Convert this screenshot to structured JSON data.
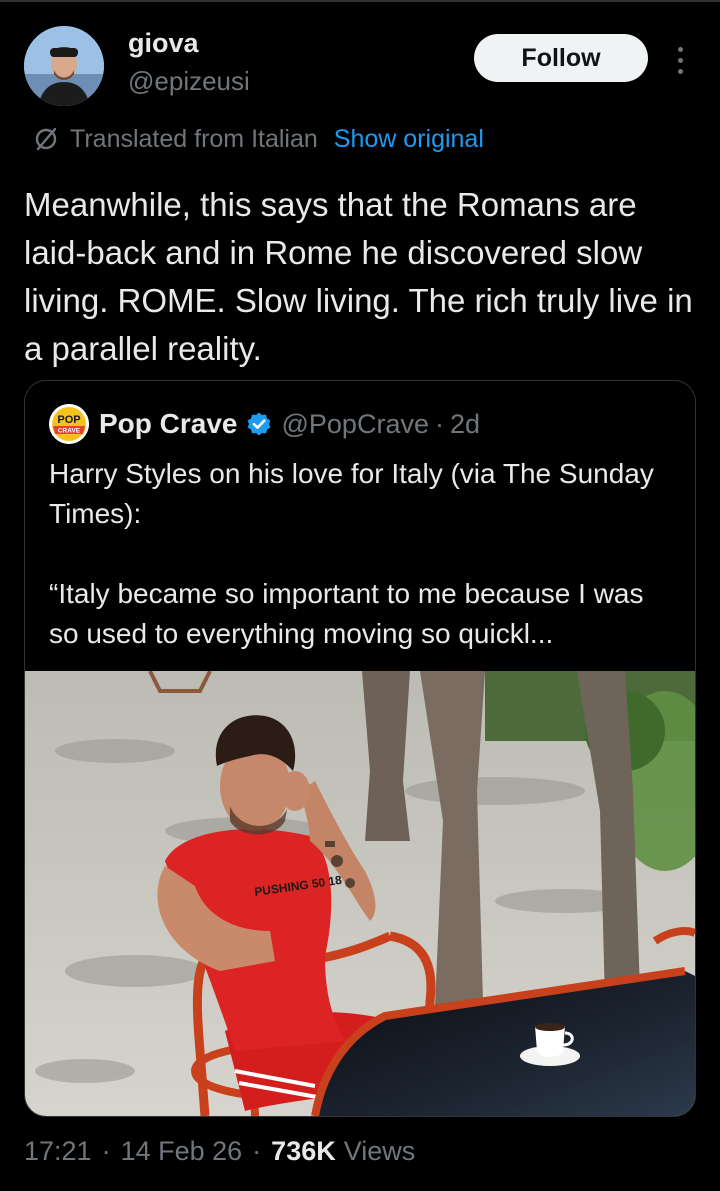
{
  "author": {
    "display_name": "giova",
    "handle": "@epizeusi"
  },
  "actions": {
    "follow_label": "Follow"
  },
  "translation": {
    "label": "Translated from Italian",
    "show_original": "Show original"
  },
  "tweet": {
    "text": "Meanwhile, this says that the Romans are laid-back and in Rome he discovered slow living. ROME. Slow living. The rich truly live in a parallel reality."
  },
  "quote": {
    "avatar_label": "POP CRAVE",
    "name": "Pop Crave",
    "handle": "@PopCrave",
    "separator": "·",
    "time": "2d",
    "line1": "Harry Styles on his love for Italy (via The Sunday Times):",
    "line2": "“Italy became so important to me because I was so used to everything moving so quickl...",
    "shirt_text": "PUSHING 50 18"
  },
  "meta": {
    "time": "17:21",
    "sep": "·",
    "date": "14 Feb 26",
    "views_count": "736K",
    "views_label": "Views"
  },
  "colors": {
    "background": "#000000",
    "text_primary": "#e7e9ea",
    "text_secondary": "#71767b",
    "link": "#1d9bf0",
    "border": "#2f3336",
    "verified": "#1d9bf0"
  }
}
